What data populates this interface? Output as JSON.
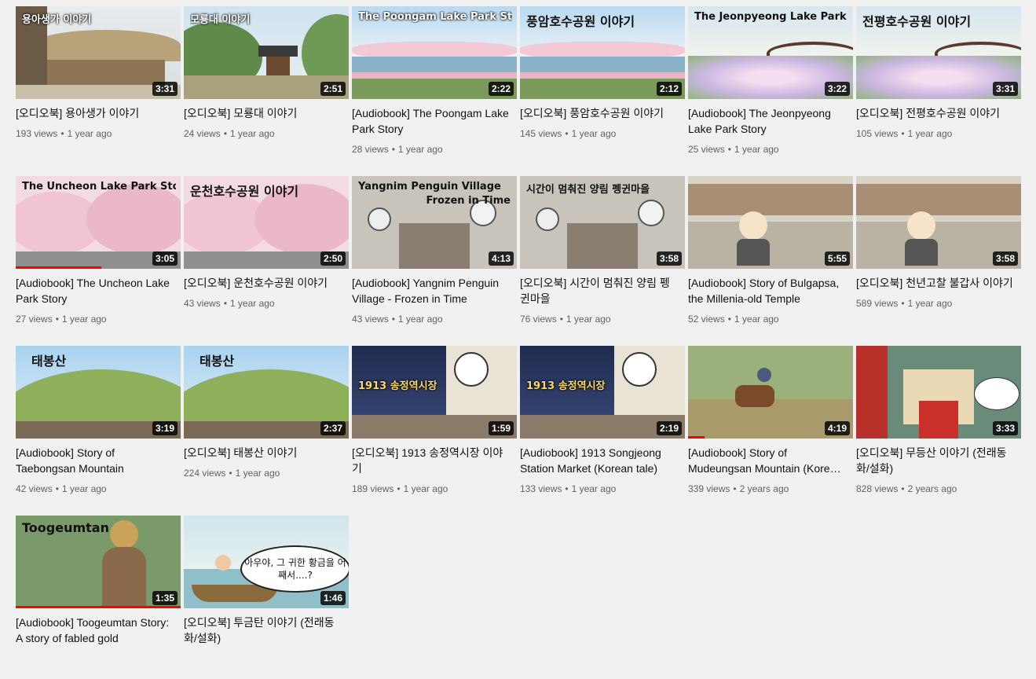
{
  "videos": [
    {
      "title": "[오디오북] 용아생가 이야기",
      "views": "193 views",
      "age": "1 year ago",
      "duration": "3:31",
      "thumb_text": "용아생가 이야기"
    },
    {
      "title": "[오디오북] 모룡대 이야기",
      "views": "24 views",
      "age": "1 year ago",
      "duration": "2:51",
      "thumb_text": "모룡대 이야기"
    },
    {
      "title": "[Audiobook] The Poongam Lake Park Story",
      "views": "28 views",
      "age": "1 year ago",
      "duration": "2:22",
      "thumb_text": "The Poongam Lake Park Story"
    },
    {
      "title": "[오디오북] 풍암호수공원 이야기",
      "views": "145 views",
      "age": "1 year ago",
      "duration": "2:12",
      "thumb_text": "풍암호수공원 이야기"
    },
    {
      "title": "[Audiobook] The Jeonpyeong Lake Park Story",
      "views": "25 views",
      "age": "1 year ago",
      "duration": "3:22",
      "thumb_text": "The Jeonpyeong Lake Park Story"
    },
    {
      "title": "[오디오북] 전평호수공원 이야기",
      "views": "105 views",
      "age": "1 year ago",
      "duration": "3:31",
      "thumb_text": "전평호수공원 이야기"
    },
    {
      "title": "[Audiobook] The Uncheon Lake Park Story",
      "views": "27 views",
      "age": "1 year ago",
      "duration": "3:05",
      "thumb_text": "The Uncheon Lake Park Story",
      "progress": 0.52
    },
    {
      "title": "[오디오북] 운천호수공원 이야기",
      "views": "43 views",
      "age": "1 year ago",
      "duration": "2:50",
      "thumb_text": "운천호수공원 이야기"
    },
    {
      "title": "[Audiobook] Yangnim Penguin Village - Frozen in Time",
      "views": "43 views",
      "age": "1 year ago",
      "duration": "4:13",
      "thumb_text": "Yangnim Penguin Village",
      "thumb_text2": "Frozen in Time"
    },
    {
      "title": "[오디오북] 시간이 멈춰진 양림 펭귄마을",
      "views": "76 views",
      "age": "1 year ago",
      "duration": "3:58",
      "thumb_text": "시간이 멈춰진 양림 펭귄마을"
    },
    {
      "title": "[Audiobook] Story of Bulgapsa, the Millenia-old Temple",
      "views": "52 views",
      "age": "1 year ago",
      "duration": "5:55"
    },
    {
      "title": "[오디오북] 천년고찰 불갑사 이야기",
      "views": "589 views",
      "age": "1 year ago",
      "duration": "3:58"
    },
    {
      "title": "[Audiobook] Story of Taebongsan Mountain",
      "views": "42 views",
      "age": "1 year ago",
      "duration": "3:19",
      "thumb_text": "태봉산"
    },
    {
      "title": "[오디오북] 태봉산 이야기",
      "views": "224 views",
      "age": "1 year ago",
      "duration": "2:37",
      "thumb_text": "태봉산"
    },
    {
      "title": "[오디오북] 1913 송정역시장 이야기",
      "views": "189 views",
      "age": "1 year ago",
      "duration": "1:59",
      "thumb_text": "1913 송정역시장"
    },
    {
      "title": "[Audiobook] 1913 Songjeong Station Market (Korean tale)",
      "views": "133 views",
      "age": "1 year ago",
      "duration": "2:19",
      "thumb_text": "1913 송정역시장"
    },
    {
      "title": "[Audiobook] Story of Mudeungsan Mountain (Korean tale)",
      "views": "339 views",
      "age": "2 years ago",
      "duration": "4:19",
      "progress": 0.1
    },
    {
      "title": "[오디오북] 무등산 이야기 (전래동화/설화)",
      "views": "828 views",
      "age": "2 years ago",
      "duration": "3:33"
    },
    {
      "title": "[Audiobook] Toogeumtan Story: A story of fabled gold",
      "duration": "1:35",
      "thumb_text": "Toogeumtan",
      "progress": 1.0
    },
    {
      "title": "[오디오북] 투금탄 이야기 (전래동화/설화)",
      "duration": "1:46",
      "thumb_text": "아우야, 그 귀한 황금을 어째서....?"
    }
  ],
  "colors": {
    "progress": "#ff0000",
    "meta": "#606060",
    "bg": "#f1f1f1"
  }
}
